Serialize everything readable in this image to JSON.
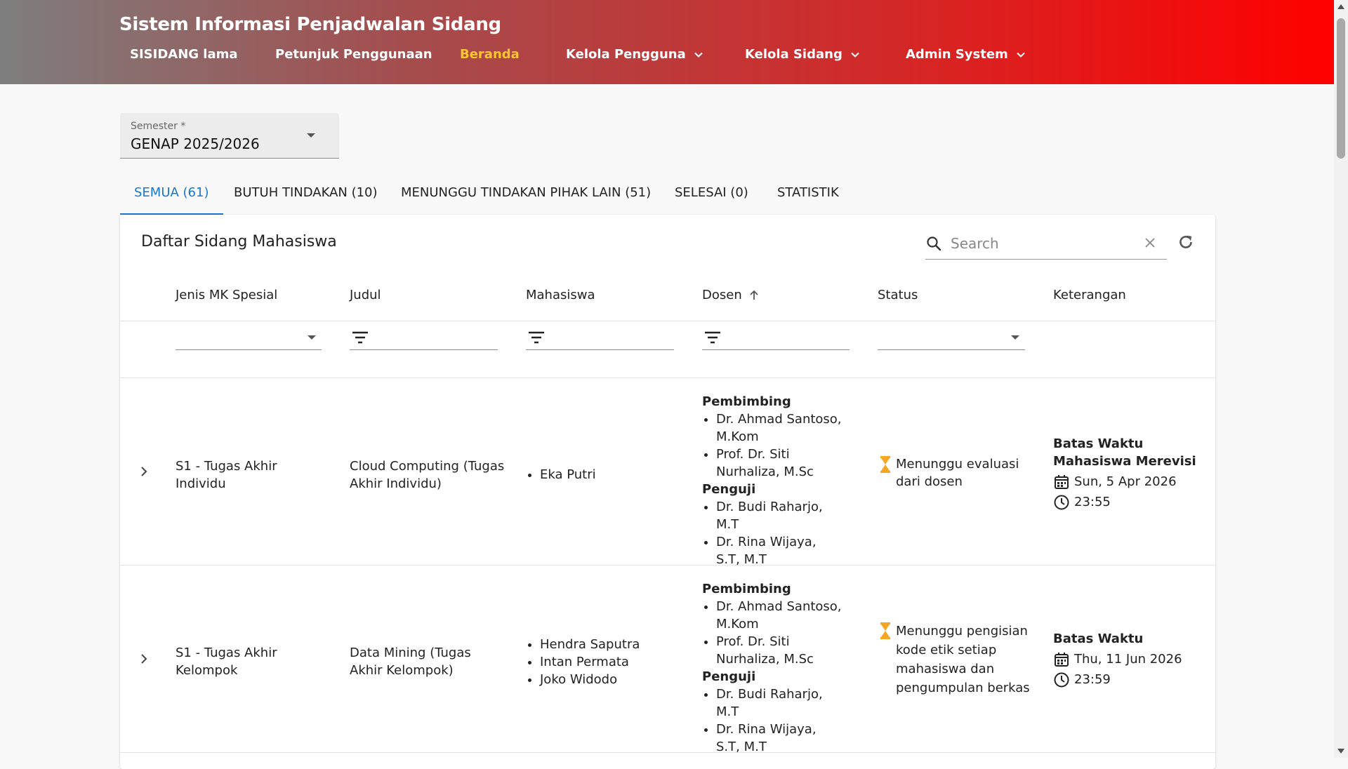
{
  "header": {
    "title": "Sistem Informasi Penjadwalan Sidang",
    "nav": [
      {
        "label": "SISIDANG lama"
      },
      {
        "label": "Petunjuk Penggunaan"
      },
      {
        "label": "Beranda",
        "active": true
      },
      {
        "label": "Kelola Pengguna",
        "dropdown": true
      },
      {
        "label": "Kelola Sidang",
        "dropdown": true
      },
      {
        "label": "Admin System",
        "dropdown": true
      }
    ]
  },
  "semester": {
    "label": "Semester *",
    "value": "GENAP 2025/2026"
  },
  "tabs": [
    {
      "label": "SEMUA (61)",
      "active": true
    },
    {
      "label": "BUTUH TINDAKAN (10)"
    },
    {
      "label": "MENUNGGU TINDAKAN PIHAK LAIN (51)"
    },
    {
      "label": "SELESAI (0)"
    },
    {
      "label": "STATISTIK"
    }
  ],
  "card": {
    "title": "Daftar Sidang Mahasiswa",
    "search_placeholder": "Search",
    "columns": [
      "Jenis MK Spesial",
      "Judul",
      "Mahasiswa",
      "Dosen",
      "Status",
      "Keterangan"
    ],
    "sorted_column": "Dosen"
  },
  "rows": [
    {
      "jenis_line1": "S1 - Tugas Akhir",
      "jenis_line2": "Individu",
      "judul_line1": "Cloud Computing (Tugas",
      "judul_line2": "Akhir Individu)",
      "mahasiswa": [
        "Eka Putri"
      ],
      "pembimbing_label": "Pembimbing",
      "pembimbing": [
        "Dr. Ahmad Santoso, M.Kom",
        "Prof. Dr. Siti Nurhaliza, M.Sc"
      ],
      "penguji_label": "Penguji",
      "penguji": [
        "Dr. Budi Raharjo, M.T",
        "Dr. Rina Wijaya, S.T, M.T"
      ],
      "status": "Menunggu evaluasi dari dosen",
      "ket_title": "Batas Waktu Mahasiswa Merevisi",
      "date": "Sun, 5 Apr 2026",
      "time": "23:55"
    },
    {
      "jenis_line1": "S1 - Tugas Akhir",
      "jenis_line2": "Kelompok",
      "judul_line1": "Data Mining (Tugas",
      "judul_line2": "Akhir Kelompok)",
      "mahasiswa": [
        "Hendra Saputra",
        "Intan Permata",
        "Joko Widodo"
      ],
      "pembimbing_label": "Pembimbing",
      "pembimbing": [
        "Dr. Ahmad Santoso, M.Kom",
        "Prof. Dr. Siti Nurhaliza, M.Sc"
      ],
      "penguji_label": "Penguji",
      "penguji": [
        "Dr. Budi Raharjo, M.T",
        "Dr. Rina Wijaya, S.T, M.T"
      ],
      "status": "Menunggu pengisian kode etik setiap mahasiswa dan pengumpulan berkas",
      "ket_title": "Batas Waktu",
      "date": "Thu, 11 Jun 2026",
      "time": "23:59"
    }
  ],
  "colors": {
    "accent_tab": "#1976d2",
    "nav_active": "#ffc72c",
    "hourglass": "#f5a623"
  },
  "icons": {
    "search": "search-icon",
    "clear": "close-icon",
    "refresh": "refresh-icon",
    "sort": "arrow-up-icon",
    "filter": "filter-icon",
    "expand": "chevron-right-icon",
    "status": "hourglass-icon",
    "date": "calendar-icon",
    "time": "clock-icon"
  }
}
